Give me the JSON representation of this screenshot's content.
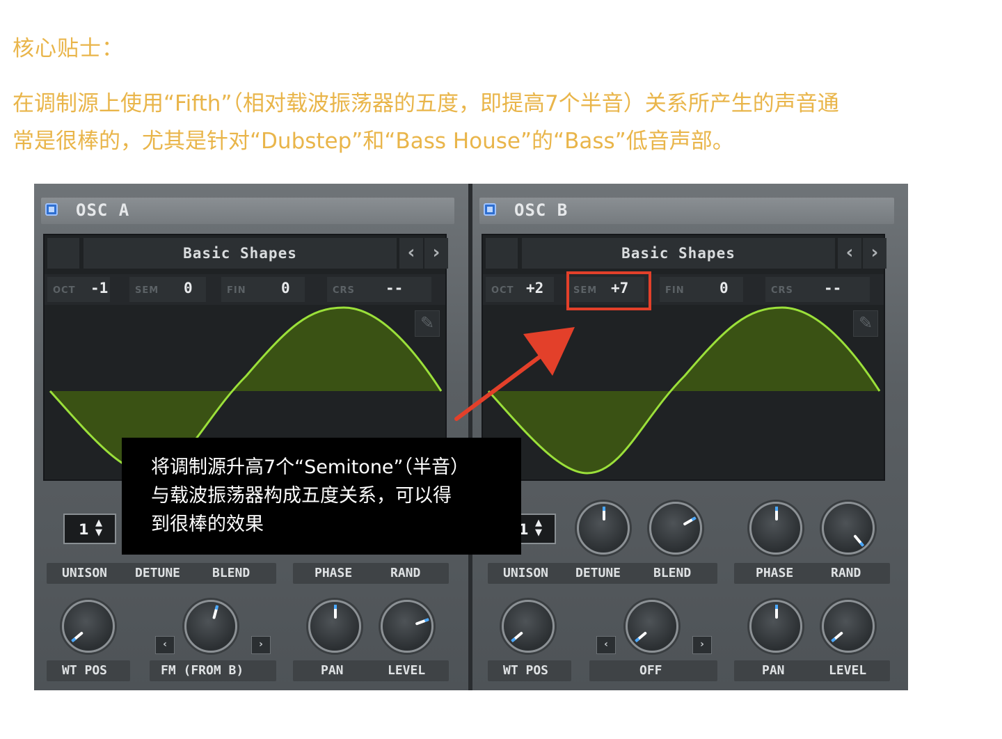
{
  "tip": {
    "title": "核心贴士：",
    "body_line1": "在调制源上使用“Fifth”（相对载波振荡器的五度，即提高7个半音）关系所产生的声音通",
    "body_line2": "常是很棒的，尤其是针对“Dubstep”和“Bass House”的“Bass”低音声部。"
  },
  "osc_a": {
    "title": "OSC A",
    "shape": "Basic Shapes",
    "oct_label": "OCT",
    "oct_value": "-1",
    "sem_label": "SEM",
    "sem_value": "0",
    "fin_label": "FIN",
    "fin_value": "0",
    "crs_label": "CRS",
    "crs_value": "--",
    "unison_value": "1",
    "labels_top": [
      "UNISON",
      "DETUNE",
      "BLEND",
      "PHASE",
      "RAND"
    ],
    "labels_bottom": [
      "WT POS",
      "FM (FROM B)",
      "PAN",
      "LEVEL"
    ]
  },
  "osc_b": {
    "title": "OSC B",
    "shape": "Basic Shapes",
    "oct_label": "OCT",
    "oct_value": "+2",
    "sem_label": "SEM",
    "sem_value": "+7",
    "fin_label": "FIN",
    "fin_value": "0",
    "crs_label": "CRS",
    "crs_value": "--",
    "unison_value": "1",
    "labels_top": [
      "UNISON",
      "DETUNE",
      "BLEND",
      "PHASE",
      "RAND"
    ],
    "labels_bottom": [
      "WT POS",
      "OFF",
      "PAN",
      "LEVEL"
    ]
  },
  "callout": {
    "line1": "将调制源升高7个“Semitone”（半音）",
    "line2": "与载波振荡器构成五度关系，可以得",
    "line3": "到很棒的效果"
  },
  "icons": {
    "prev": "‹",
    "next": "›",
    "spin": "▲▼",
    "small_prev": "‹",
    "small_next": "›",
    "pencil": "✎"
  },
  "colors": {
    "tip_text": "#e9b54a",
    "wave_stroke": "#9be03a",
    "wave_fill": "#3f5a12",
    "highlight": "#e3402a",
    "enable_blue": "#2f6fd0"
  }
}
